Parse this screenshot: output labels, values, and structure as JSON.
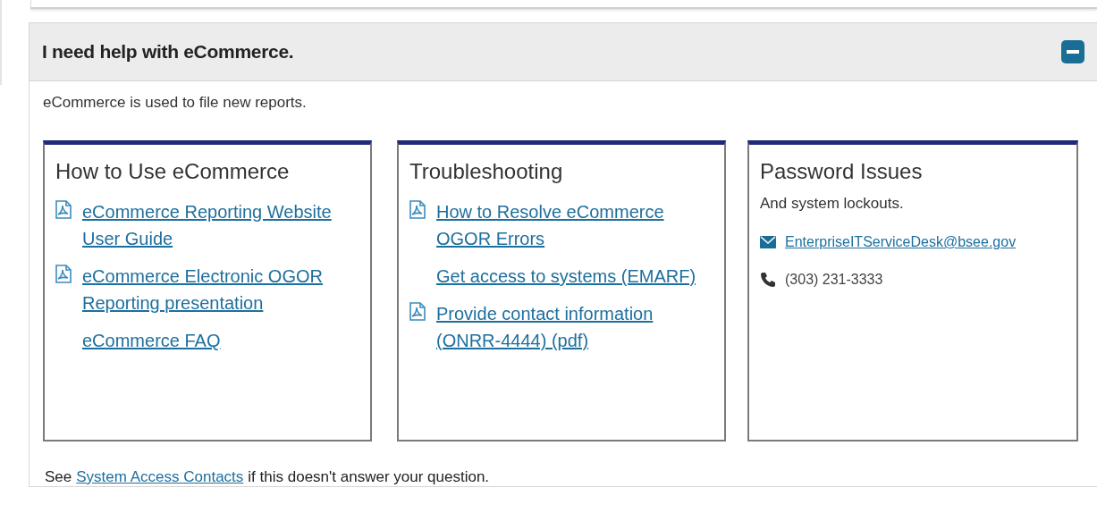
{
  "accordion": {
    "title": "I need help with eCommerce.",
    "expanded": true,
    "intro": "eCommerce is used to file new reports.",
    "cards": [
      {
        "title": "How to Use eCommerce",
        "items": [
          {
            "kind": "pdf",
            "text": "eCommerce Reporting Website User Guide"
          },
          {
            "kind": "pdf",
            "text": "eCommerce Electronic OGOR Reporting presentation"
          },
          {
            "kind": "link",
            "text": "eCommerce FAQ"
          }
        ]
      },
      {
        "title": "Troubleshooting",
        "items": [
          {
            "kind": "pdf",
            "text": "How to Resolve eCommerce OGOR Errors"
          },
          {
            "kind": "link",
            "text": "Get access to systems (EMARF)"
          },
          {
            "kind": "pdf",
            "text": "Provide contact information (ONRR-4444) (pdf)"
          }
        ]
      },
      {
        "title": "Password Issues",
        "items": [
          {
            "kind": "text",
            "text": "And system lockouts."
          },
          {
            "kind": "email",
            "text": "EnterpriseITServiceDesk@bsee.gov"
          },
          {
            "kind": "phone",
            "text": "(303) 231-3333"
          }
        ]
      }
    ],
    "footer": {
      "before": "See",
      "link": "System Access Contacts",
      "after": "if this doesn't answer your question."
    }
  }
}
